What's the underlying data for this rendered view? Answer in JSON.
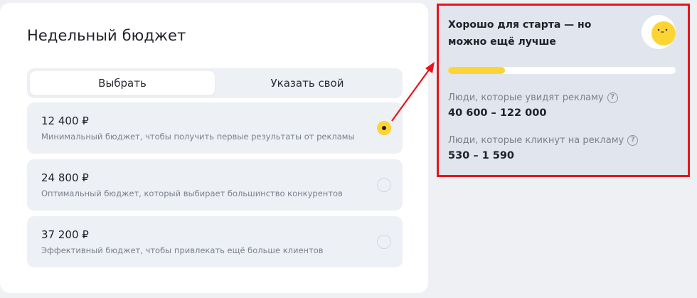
{
  "budget": {
    "title": "Недельный бюджет",
    "tabs": [
      {
        "label": "Выбрать",
        "active": true
      },
      {
        "label": "Указать свой",
        "active": false
      }
    ],
    "options": [
      {
        "price": "12 400 ₽",
        "description": "Минимальный бюджет, чтобы получить первые результаты от рекламы",
        "selected": true
      },
      {
        "price": "24 800 ₽",
        "description": "Оптимальный бюджет, который выбирает большинство конкурентов",
        "selected": false
      },
      {
        "price": "37 200 ₽",
        "description": "Эффективный бюджет, чтобы привлекать ещё больше клиентов",
        "selected": false
      }
    ]
  },
  "forecast": {
    "title": "Хорошо для старта — но можно ещё лучше",
    "mascot_icon": "smiley-face-icon",
    "progress_fraction": 0.25,
    "reach_label": "Люди, которые увидят рекламу",
    "reach_value": "40 600 – 122 000",
    "clicks_label": "Люди, которые кликнут на рекламу",
    "clicks_value": "530 – 1 590",
    "help_icon": "question-circle-icon"
  },
  "colors": {
    "accent_yellow": "#fcd535",
    "highlight_red": "#e8141c",
    "panel_bg": "#e1e5ee",
    "card_bg": "#ffffff",
    "option_bg": "#edf0f5"
  }
}
